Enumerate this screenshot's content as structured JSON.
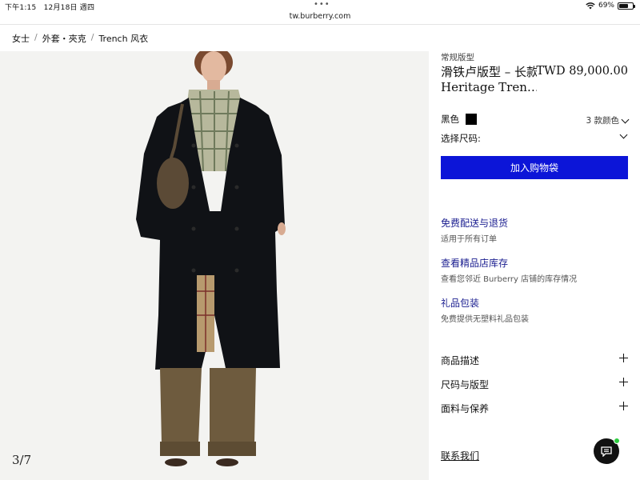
{
  "status_bar": {
    "time": "下午1:15",
    "date": "12月18日 週四",
    "battery": "69%",
    "battery_level": 0.69
  },
  "browser": {
    "url": "tw.burberry.com"
  },
  "breadcrumb": [
    "女士",
    "外套・夾克",
    "Trench 风衣"
  ],
  "product": {
    "fit": "常规版型",
    "title_line1": "滑铁卢版型 – 长款",
    "title_line2": "Heritage Tren…",
    "price": "TWD 89,000.00",
    "color_label": "黑色",
    "color_hex": "#000000",
    "color_count": "3 款颜色",
    "size_label": "选择尺码:",
    "add_to_bag": "加入购物袋",
    "image_counter": "3/7"
  },
  "services": [
    {
      "title": "免费配送与退货",
      "subtitle": "适用于所有订单"
    },
    {
      "title": "查看精品店库存",
      "subtitle": "查看您邻近 Burberry 店铺的库存情况"
    },
    {
      "title": "礼品包装",
      "subtitle": "免费提供无塑料礼品包装"
    }
  ],
  "accordion": [
    "商品描述",
    "尺码与版型",
    "面料与保养"
  ],
  "contact": "联系我们",
  "colors": {
    "accent_button": "#0c15d8",
    "link_title": "#1a1d8f",
    "chat_online": "#2ecc40"
  }
}
